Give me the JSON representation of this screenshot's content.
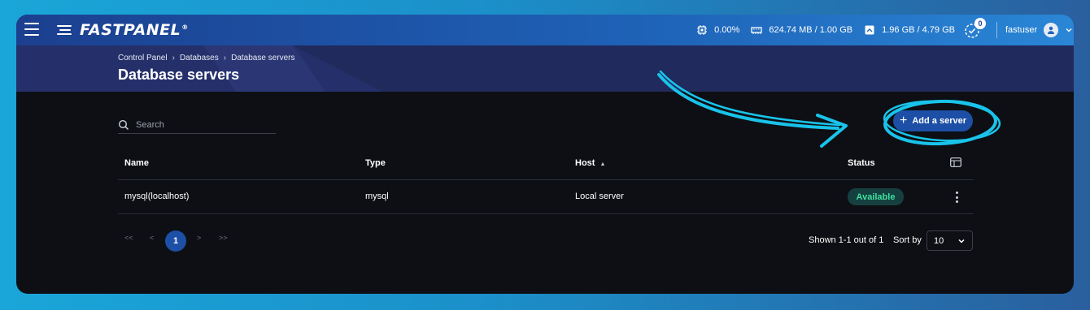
{
  "app": {
    "logo_text": "FASTPANEL",
    "logo_reg": "®"
  },
  "topbar": {
    "cpu": "0.00%",
    "memory": "624.74 MB / 1.00 GB",
    "disk": "1.96 GB / 4.79 GB",
    "tasks_count": "0",
    "username": "fastuser"
  },
  "breadcrumb": {
    "items": [
      "Control Panel",
      "Databases",
      "Database servers"
    ]
  },
  "page_title": "Database servers",
  "search": {
    "placeholder": "Search",
    "value": ""
  },
  "toolbar": {
    "add_label": "Add a server"
  },
  "table": {
    "headers": [
      "Name",
      "Type",
      "Host",
      "Status"
    ],
    "sorted_column": "Host",
    "sort_direction": "ascending",
    "rows": [
      {
        "name": "mysql(localhost)",
        "type": "mysql",
        "host": "Local server",
        "status": "Available"
      }
    ]
  },
  "pagination": {
    "first": "<<",
    "prev": "<",
    "current": "1",
    "next": ">",
    "last": ">>",
    "shown_text": "Shown 1-1 out of 1",
    "sort_by_label": "Sort by",
    "per_page": "10"
  },
  "colors": {
    "accent": "#1d4fa6",
    "annotation": "#19c3ea",
    "status_available": "#3ee0a0",
    "background": "#0d0f14"
  }
}
